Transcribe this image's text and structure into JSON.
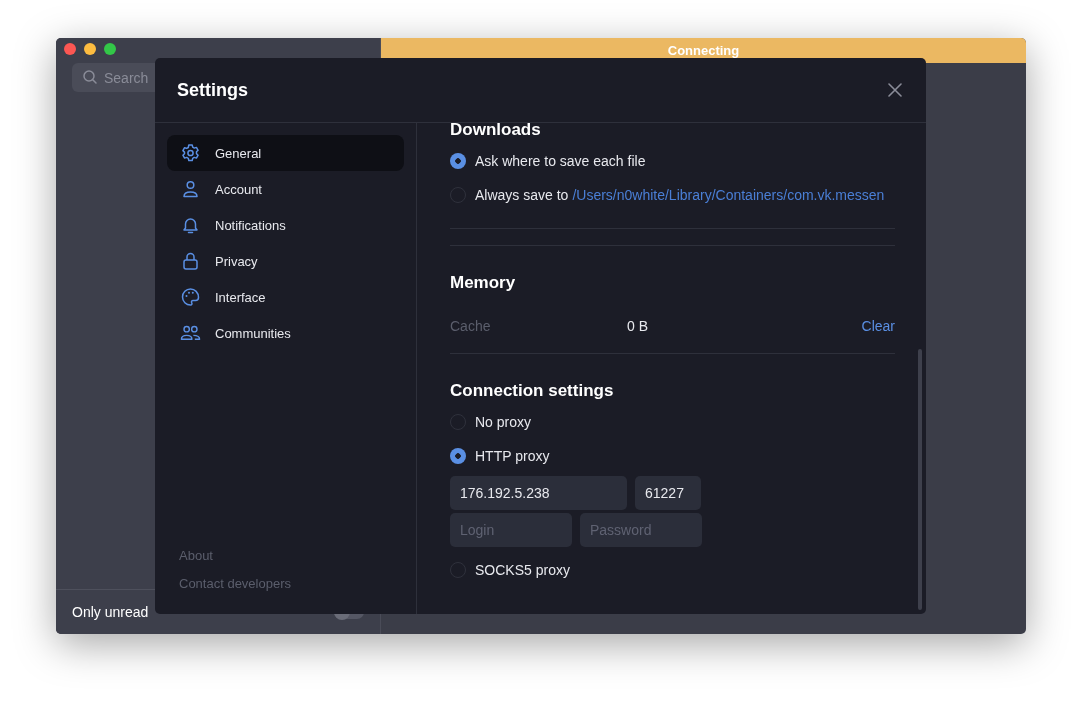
{
  "window": {
    "connection_banner": "Connecting",
    "search": {
      "placeholder": "Search"
    },
    "filter": {
      "label": "Only unread",
      "on": false
    }
  },
  "settings": {
    "title": "Settings",
    "nav": [
      {
        "label": "General",
        "kind": "gear",
        "selected": true
      },
      {
        "label": "Account",
        "kind": "person",
        "selected": false
      },
      {
        "label": "Notifications",
        "kind": "bell",
        "selected": false
      },
      {
        "label": "Privacy",
        "kind": "lock",
        "selected": false
      },
      {
        "label": "Interface",
        "kind": "palette",
        "selected": false
      },
      {
        "label": "Communities",
        "kind": "people",
        "selected": false
      }
    ],
    "footer_links": [
      "About",
      "Contact developers"
    ],
    "downloads": {
      "title": "Downloads",
      "options": [
        {
          "label": "Ask where to save each file",
          "selected": true
        },
        {
          "label": "Always save to",
          "path": "/Users/n0white/Library/Containers/com.vk.messen",
          "selected": false
        }
      ]
    },
    "memory": {
      "title": "Memory",
      "rows": [
        {
          "label": "Cache",
          "value": "0 B",
          "action": "Clear"
        }
      ]
    },
    "connection": {
      "title": "Connection settings",
      "options": [
        {
          "label": "No proxy",
          "selected": false
        },
        {
          "label": "HTTP proxy",
          "selected": true,
          "fields": [
            [
              {
                "value": "176.192.5.238"
              },
              {
                "value": "61227"
              }
            ],
            [
              {
                "placeholder": "Login"
              },
              {
                "placeholder": "Password"
              }
            ]
          ]
        },
        {
          "label": "SOCKS5 proxy",
          "selected": false
        }
      ]
    }
  }
}
